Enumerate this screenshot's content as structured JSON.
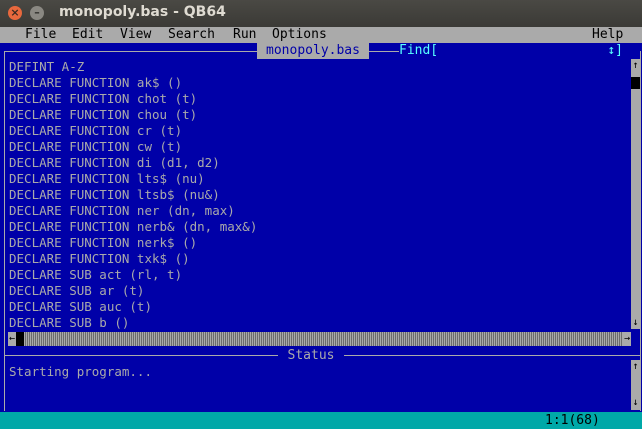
{
  "window": {
    "title": "monopoly.bas - QB64"
  },
  "menu": [
    "File",
    "Edit",
    "View",
    "Search",
    "Run",
    "Options",
    "Help"
  ],
  "editor": {
    "tab_title": "monopoly.bas",
    "find_label": "Find[",
    "find_arrows": "↕]",
    "lines": [
      "DEFINT A-Z",
      "DECLARE FUNCTION ak$ ()",
      "DECLARE FUNCTION chot (t)",
      "DECLARE FUNCTION chou (t)",
      "DECLARE FUNCTION cr (t)",
      "DECLARE FUNCTION cw (t)",
      "DECLARE FUNCTION di (d1, d2)",
      "DECLARE FUNCTION lts$ (nu)",
      "DECLARE FUNCTION ltsb$ (nu&)",
      "DECLARE FUNCTION ner (dn, max)",
      "DECLARE FUNCTION nerb& (dn, max&)",
      "DECLARE FUNCTION nerk$ ()",
      "DECLARE FUNCTION txk$ ()",
      "DECLARE SUB act (rl, t)",
      "DECLARE SUB ar (t)",
      "DECLARE SUB auc (t)",
      "DECLARE SUB b ()"
    ]
  },
  "status": {
    "title": "Status",
    "message": "Starting program..."
  },
  "statusbar": {
    "cursor": "1:1(68)"
  },
  "colors": {
    "background": "#0000a8",
    "text": "#aaaaaa",
    "find": "#57ffff",
    "bottombar": "#00a8a8"
  }
}
